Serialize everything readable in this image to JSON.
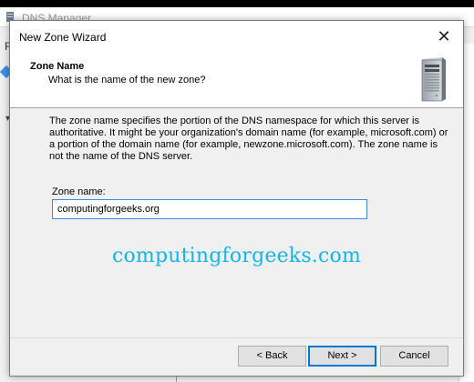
{
  "background_window": {
    "title": "DNS Manager",
    "menu_first_letter": "F"
  },
  "wizard": {
    "title": "New Zone Wizard",
    "close_symbol": "✕",
    "header": {
      "heading": "Zone Name",
      "subheading": "What is the name of the new zone?"
    },
    "description": "The zone name specifies the portion of the DNS namespace for which this server is authoritative. It might be your organization's domain name (for example, microsoft.com) or a portion of the domain name (for example, newzone.microsoft.com). The zone name is not the name of the DNS server.",
    "zone_name": {
      "label": "Zone name:",
      "value": "computingforgeeks.org"
    },
    "watermark": "computingforgeeks.com",
    "buttons": {
      "back": "< Back",
      "next": "Next >",
      "cancel": "Cancel"
    }
  },
  "colors": {
    "accent": "#0078d7",
    "watermark": "#13b6ee"
  },
  "icons": [
    "server-icon",
    "close-icon",
    "dns-manager-icon"
  ]
}
